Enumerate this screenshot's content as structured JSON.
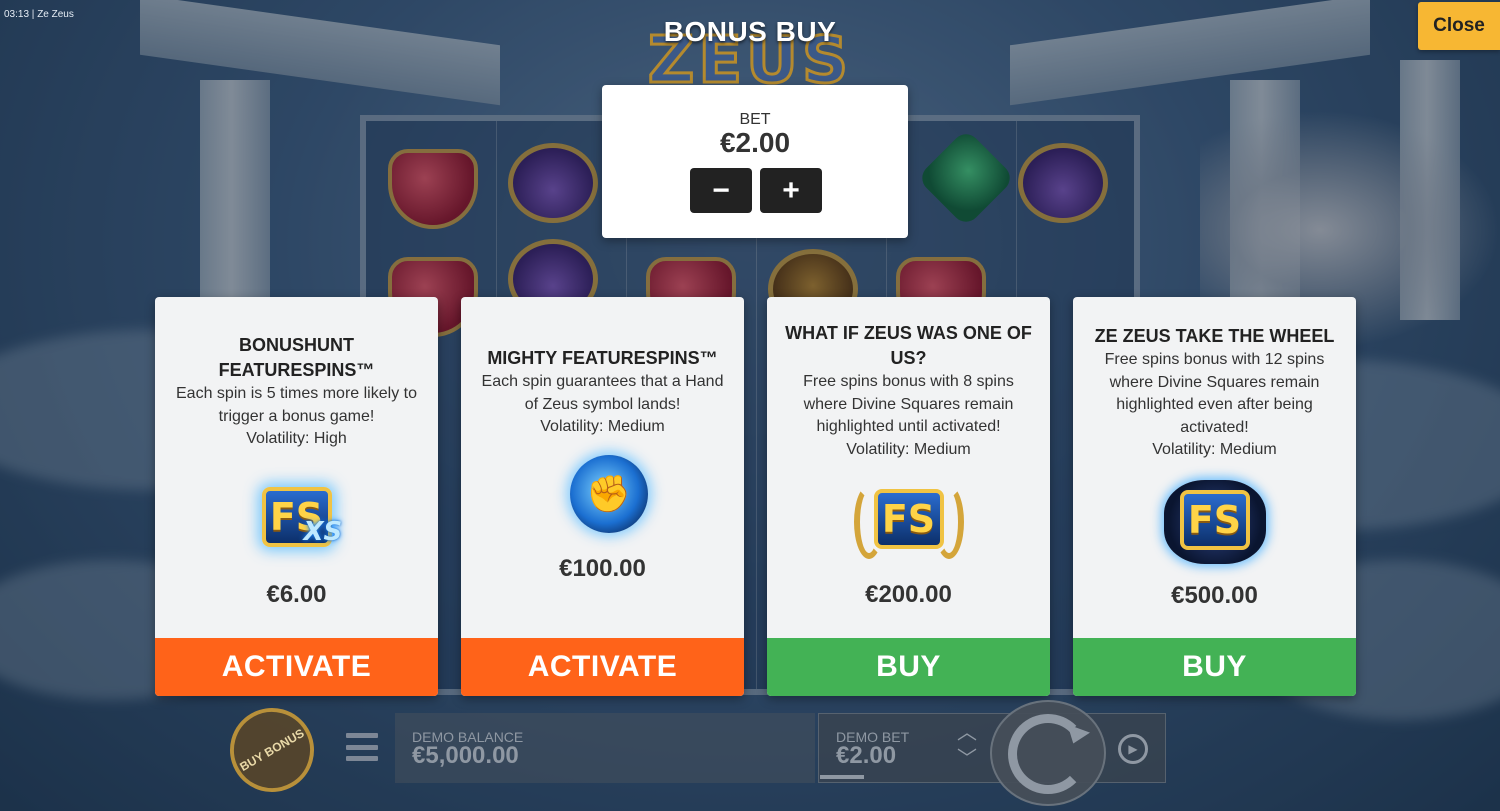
{
  "status": {
    "time": "03:13",
    "game_name": "Ze Zeus"
  },
  "logo": {
    "text": "ZEUS"
  },
  "title": "BONUS BUY",
  "close_label": "Close",
  "bet": {
    "label": "BET",
    "value": "€2.00",
    "minus": "−",
    "plus": "+"
  },
  "cards": [
    {
      "title": "BONUSHUNT FEATURESPINS™",
      "description": "Each spin is 5 times more likely to trigger a bonus game!",
      "volatility": "Volatility: High",
      "icon": "fs-xs-icon",
      "icon_text": "FS",
      "icon_tag": "XS",
      "price": "€6.00",
      "action": "ACTIVATE",
      "action_color": "#ff6319"
    },
    {
      "title": "MIGHTY FEATURESPINS™",
      "description": "Each spin guarantees that a Hand of Zeus symbol lands!",
      "volatility": "Volatility: Medium",
      "icon": "hand-of-zeus-icon",
      "price": "€100.00",
      "action": "ACTIVATE",
      "action_color": "#ff6319"
    },
    {
      "title": "WHAT IF ZEUS WAS ONE OF US?",
      "description": "Free spins bonus with 8 spins where Divine Squares remain highlighted until activated!",
      "volatility": "Volatility: Medium",
      "icon": "fs-laurel-icon",
      "icon_text": "FS",
      "price": "€200.00",
      "action": "BUY",
      "action_color": "#43b255"
    },
    {
      "title": "ZE ZEUS TAKE THE WHEEL",
      "description": "Free spins bonus with 12 spins where Divine Squares remain highlighted even after being activated!",
      "volatility": "Volatility: Medium",
      "icon": "fs-storm-icon",
      "icon_text": "FS",
      "price": "€500.00",
      "action": "BUY",
      "action_color": "#43b255"
    }
  ],
  "bottom_bar": {
    "buy_bonus": "BUY BONUS",
    "balance_label": "DEMO BALANCE",
    "balance_value": "€5,000.00",
    "bet_label": "DEMO BET",
    "bet_value": "€2.00"
  },
  "colors": {
    "close": "#f7b733",
    "activate": "#ff6319",
    "buy": "#43b255"
  }
}
